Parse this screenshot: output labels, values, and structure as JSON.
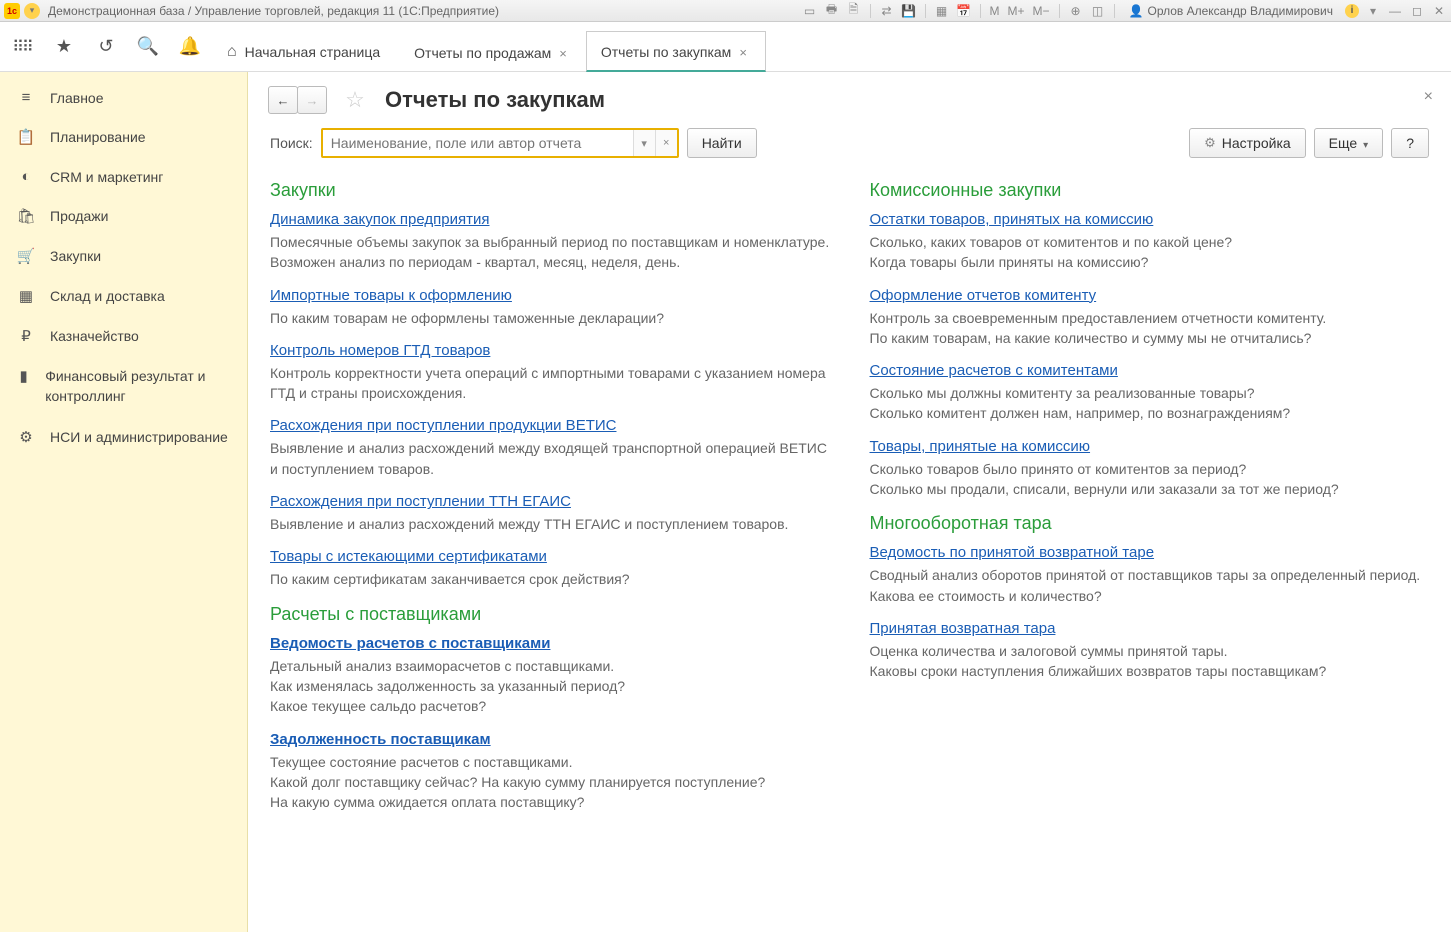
{
  "titlebar": {
    "title": "Демонстрационная база / Управление торговлей, редакция 11 (1С:Предприятие)",
    "user": "Орлов Александр Владимирович"
  },
  "tabs": {
    "home": "Начальная страница",
    "t1": "Отчеты по продажам",
    "t2": "Отчеты по закупкам"
  },
  "sidebar": {
    "items": [
      {
        "icon": "≡",
        "label": "Главное"
      },
      {
        "icon": "📋",
        "label": "Планирование"
      },
      {
        "icon": "◐",
        "label": "CRM и маркетинг"
      },
      {
        "icon": "🛍",
        "label": "Продажи"
      },
      {
        "icon": "🛒",
        "label": "Закупки"
      },
      {
        "icon": "▦",
        "label": "Склад и доставка"
      },
      {
        "icon": "₽",
        "label": "Казначейство"
      },
      {
        "icon": "▮",
        "label": "Финансовый результат и контроллинг"
      },
      {
        "icon": "⚙",
        "label": "НСИ и администрирование"
      }
    ]
  },
  "page": {
    "title": "Отчеты по закупкам",
    "search_label": "Поиск:",
    "search_placeholder": "Наименование, поле или автор отчета",
    "find_btn": "Найти",
    "settings_btn": "Настройка",
    "more_btn": "Еще",
    "help_btn": "?"
  },
  "left_sections": [
    {
      "title": "Закупки",
      "reports": [
        {
          "link": "Динамика закупок предприятия",
          "desc": "Помесячные объемы закупок за выбранный период по поставщикам и номенклатуре.\nВозможен анализ по периодам - квартал, месяц, неделя, день."
        },
        {
          "link": "Импортные товары к оформлению",
          "desc": "По каким товарам не оформлены таможенные декларации?"
        },
        {
          "link": "Контроль номеров ГТД товаров",
          "desc": "Контроль корректности учета операций с импортными товарами с указанием номера ГТД и страны происхождения."
        },
        {
          "link": "Расхождения при поступлении продукции ВЕТИС",
          "desc": "Выявление и анализ расхождений между входящей транспортной операцией ВЕТИС и поступлением товаров."
        },
        {
          "link": "Расхождения при поступлении ТТН ЕГАИС",
          "desc": "Выявление и анализ расхождений между ТТН ЕГАИС и поступлением товаров."
        },
        {
          "link": "Товары с истекающими сертификатами",
          "desc": "По каким сертификатам заканчивается срок действия?"
        }
      ]
    },
    {
      "title": "Расчеты с поставщиками",
      "reports": [
        {
          "link": "Ведомость расчетов с поставщиками",
          "bold": true,
          "desc": "Детальный анализ взаиморасчетов с поставщиками.\nКак изменялась задолженность за указанный период?\nКакое текущее сальдо расчетов?"
        },
        {
          "link": "Задолженность поставщикам",
          "bold": true,
          "desc": "Текущее состояние расчетов с поставщиками.\nКакой долг поставщику сейчас? На какую сумму планируется поступление?\nНа какую сумма ожидается оплата поставщику?"
        }
      ]
    }
  ],
  "right_sections": [
    {
      "title": "Комиссионные закупки",
      "reports": [
        {
          "link": "Остатки товаров, принятых на комиссию",
          "desc": "Сколько, каких товаров от комитентов и по какой цене?\nКогда товары были приняты на комиссию?"
        },
        {
          "link": "Оформление отчетов комитенту",
          "desc": "Контроль за своевременным предоставлением отчетности комитенту.\nПо каким товарам, на какие количество и сумму мы не отчитались?"
        },
        {
          "link": "Состояние расчетов с комитентами",
          "desc": "Сколько мы должны комитенту за реализованные товары?\nСколько комитент должен нам, например, по вознаграждениям?"
        },
        {
          "link": "Товары, принятые на комиссию",
          "desc": "Сколько товаров было принято от комитентов за период?\nСколько мы продали, списали, вернули или заказали за тот же период?"
        }
      ]
    },
    {
      "title": "Многооборотная тара",
      "reports": [
        {
          "link": "Ведомость по принятой возвратной таре",
          "desc": "Сводный анализ оборотов принятой от поставщиков тары за определенный период.\nКакова ее стоимость и количество?"
        },
        {
          "link": "Принятая возвратная тара",
          "desc": "Оценка количества и залоговой суммы принятой тары.\nКаковы сроки наступления ближайших возвратов тары поставщикам?"
        }
      ]
    }
  ]
}
